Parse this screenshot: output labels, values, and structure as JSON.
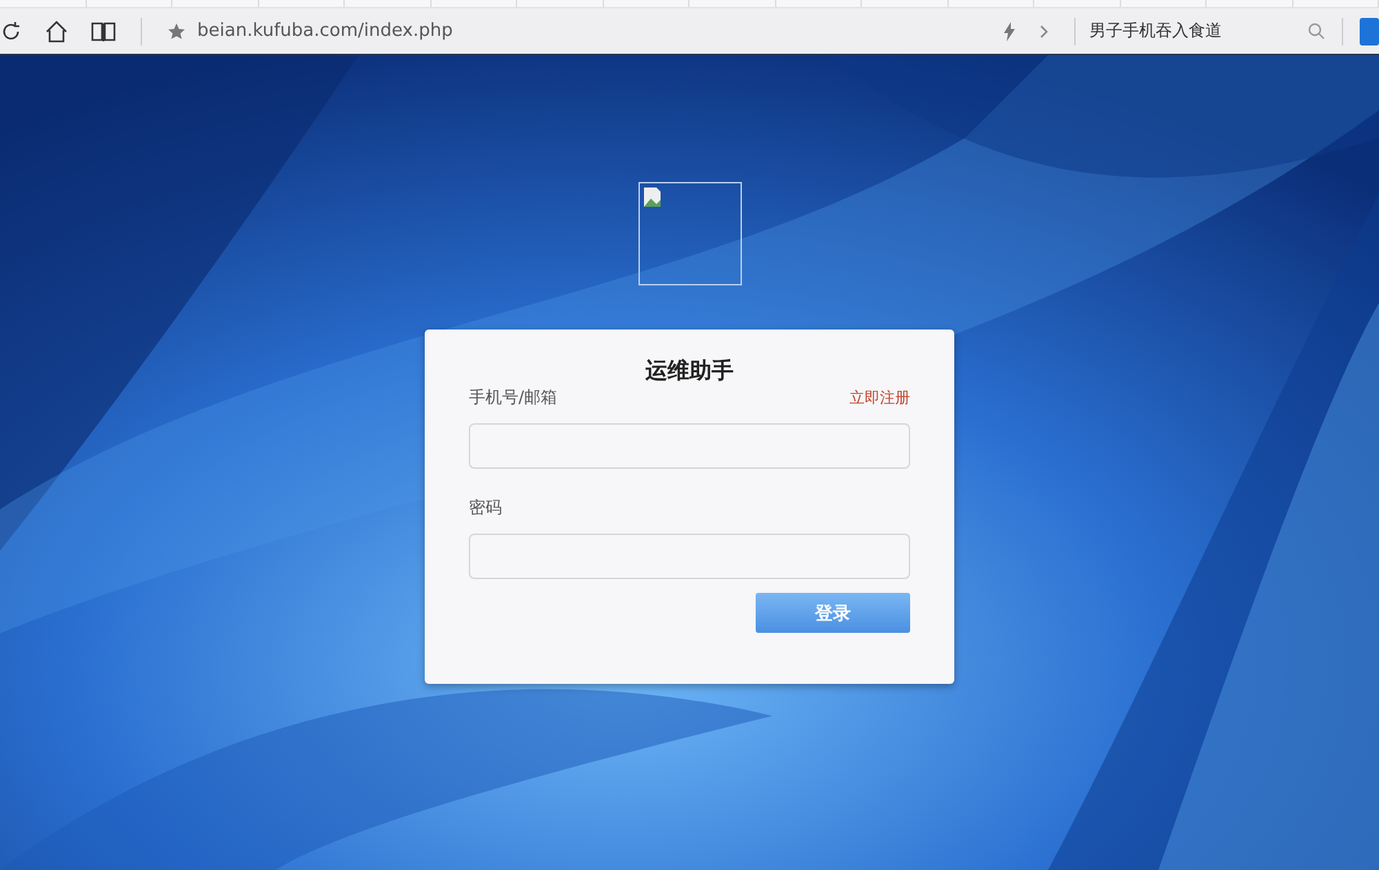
{
  "browser": {
    "address": "beian.kufuba.com/index.php",
    "search_value": "男子手机吞入食道"
  },
  "login": {
    "title": "运维助手",
    "account_label": "手机号/邮箱",
    "register_link": "立即注册",
    "password_label": "密码",
    "submit": "登录"
  }
}
